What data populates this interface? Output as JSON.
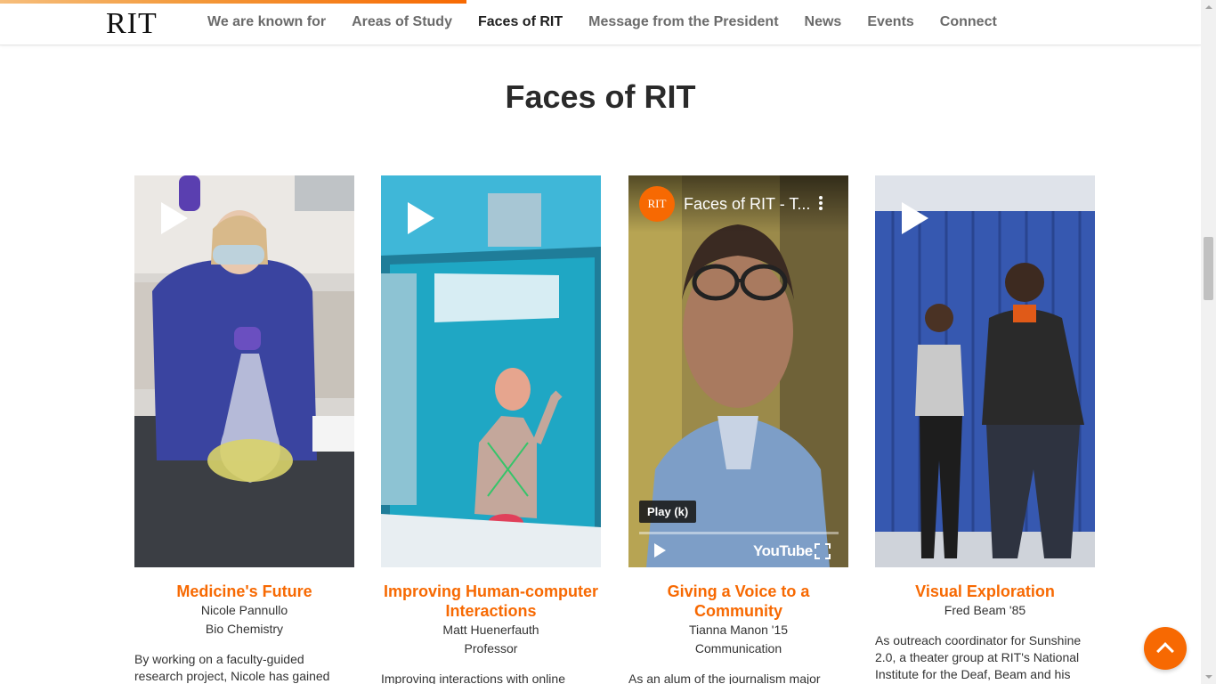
{
  "header": {
    "logo": "RIT",
    "nav": [
      {
        "label": "We are known for",
        "active": false
      },
      {
        "label": "Areas of Study",
        "active": false
      },
      {
        "label": "Faces of RIT",
        "active": true
      },
      {
        "label": "Message from the President",
        "active": false
      },
      {
        "label": "News",
        "active": false
      },
      {
        "label": "Events",
        "active": false
      },
      {
        "label": "Connect",
        "active": false
      }
    ]
  },
  "section": {
    "title": "Faces of RIT"
  },
  "cards": [
    {
      "title": "Medicine's Future",
      "name": "Nicole Pannullo",
      "role": "Bio Chemistry",
      "description": "By working on a faculty-guided research project, Nicole has gained"
    },
    {
      "title": "Improving Human-computer Interactions",
      "name": "Matt Huenerfauth",
      "role": "Professor",
      "description": "Improving interactions with online"
    },
    {
      "title": "Giving a Voice to a Community",
      "name": "Tianna Manon '15",
      "role": "Communication",
      "description": "As an alum of the journalism major"
    },
    {
      "title": "Visual Exploration",
      "name": "Fred Beam '85",
      "role": "",
      "description": "As outreach coordinator for Sunshine 2.0, a theater group at RIT's National Institute for the Deaf, Beam and his"
    }
  ],
  "video": {
    "channel_avatar": "RIT",
    "title": "Faces of RIT - T...",
    "tooltip": "Play (k)",
    "logo": "YouTube"
  },
  "icons": {
    "play": "play-icon",
    "back_to_top": "chevron-up-icon"
  },
  "colors": {
    "accent": "#f76902"
  }
}
